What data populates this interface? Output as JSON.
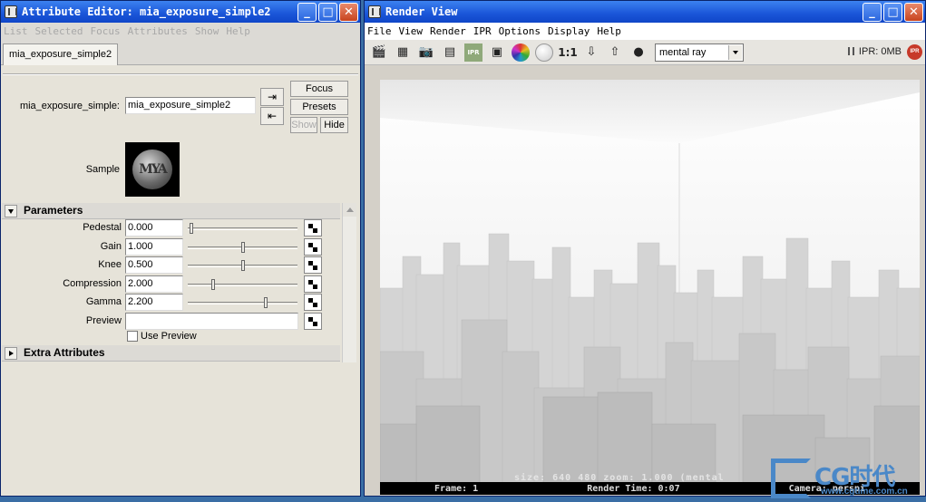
{
  "attribute_editor": {
    "title": "Attribute Editor: mia_exposure_simple2",
    "menu": [
      "List",
      "Selected",
      "Focus",
      "Attributes",
      "Show",
      "Help"
    ],
    "tab": "mia_exposure_simple2",
    "node_label": "mia_exposure_simple:",
    "node_name": "mia_exposure_simple2",
    "buttons": {
      "focus": "Focus",
      "presets": "Presets",
      "show": "Show",
      "hide": "Hide"
    },
    "sample_label": "Sample",
    "sample_logo": "MYA",
    "parameters_section": "Parameters",
    "extra_section": "Extra Attributes",
    "params": [
      {
        "label": "Pedestal",
        "value": "0.000",
        "slider_fraction": 0.02
      },
      {
        "label": "Gain",
        "value": "1.000",
        "slider_fraction": 0.5
      },
      {
        "label": "Knee",
        "value": "0.500",
        "slider_fraction": 0.5
      },
      {
        "label": "Compression",
        "value": "2.000",
        "slider_fraction": 0.22
      },
      {
        "label": "Gamma",
        "value": "2.200",
        "slider_fraction": 0.72
      }
    ],
    "preview_label": "Preview",
    "use_preview_label": "Use Preview",
    "use_preview_checked": false
  },
  "render_view": {
    "title": "Render View",
    "menu": [
      "File",
      "View",
      "Render",
      "IPR",
      "Options",
      "Display",
      "Help"
    ],
    "tool_icons": [
      "clapper-icon",
      "clapper-region-icon",
      "camera-icon",
      "clapper-ipr-icon",
      "ipr-icon",
      "clapper-snapshot-icon",
      "color-channels-icon",
      "alpha-channel-icon",
      "ratio-1-1",
      "keep-image-icon",
      "remove-image-icon",
      "render-settings-icon"
    ],
    "ipr_tool_label": "IPR",
    "ratio_label": "1:1",
    "renderer": "mental ray",
    "ipr_status": "IPR: 0MB",
    "ipr_badge": "IPR",
    "overlay_info": "size:  640  480 zoom: 1.000        (mental",
    "frame": "Frame: 1",
    "render_time": "Render Time: 0:07",
    "camera": "Camera: perspi"
  },
  "watermark": {
    "text": "CG时代",
    "url": "www.cgtime.com.cn"
  }
}
